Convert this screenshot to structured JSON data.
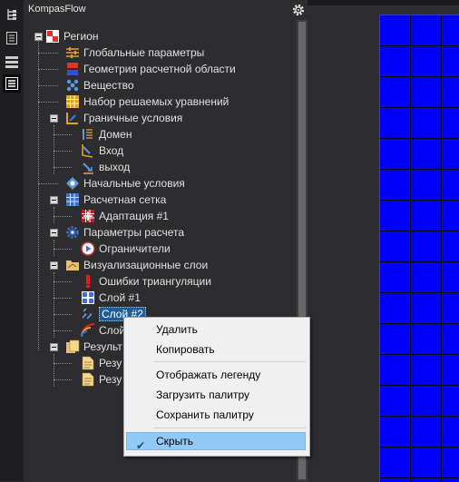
{
  "panel": {
    "title": "KompasFlow"
  },
  "tree": {
    "root": "Регион",
    "items": [
      "Глобальные параметры",
      "Геометрия расчетной области",
      "Вещество",
      "Набор решаемых уравнений",
      "Граничные условия",
      "Домен",
      "Вход",
      "выход",
      "Начальные условия",
      "Расчетная сетка",
      "Адаптация #1",
      "Параметры расчета",
      "Ограничители",
      "Визуализационные слои",
      "Ошибки триангуляции",
      "Слой #1",
      "Слой #2",
      "Слой",
      "Результ",
      "Резу",
      "Резу"
    ]
  },
  "context_menu": {
    "delete": "Удалить",
    "copy": "Копировать",
    "show_legend": "Отображать легенду",
    "load_palette": "Загрузить палитру",
    "save_palette": "Сохранить палитру",
    "hide": "Скрыть"
  },
  "colors": {
    "canvas": "#0000ff",
    "selection": "#1e5d9c",
    "menu_highlight": "#91c9f7"
  }
}
